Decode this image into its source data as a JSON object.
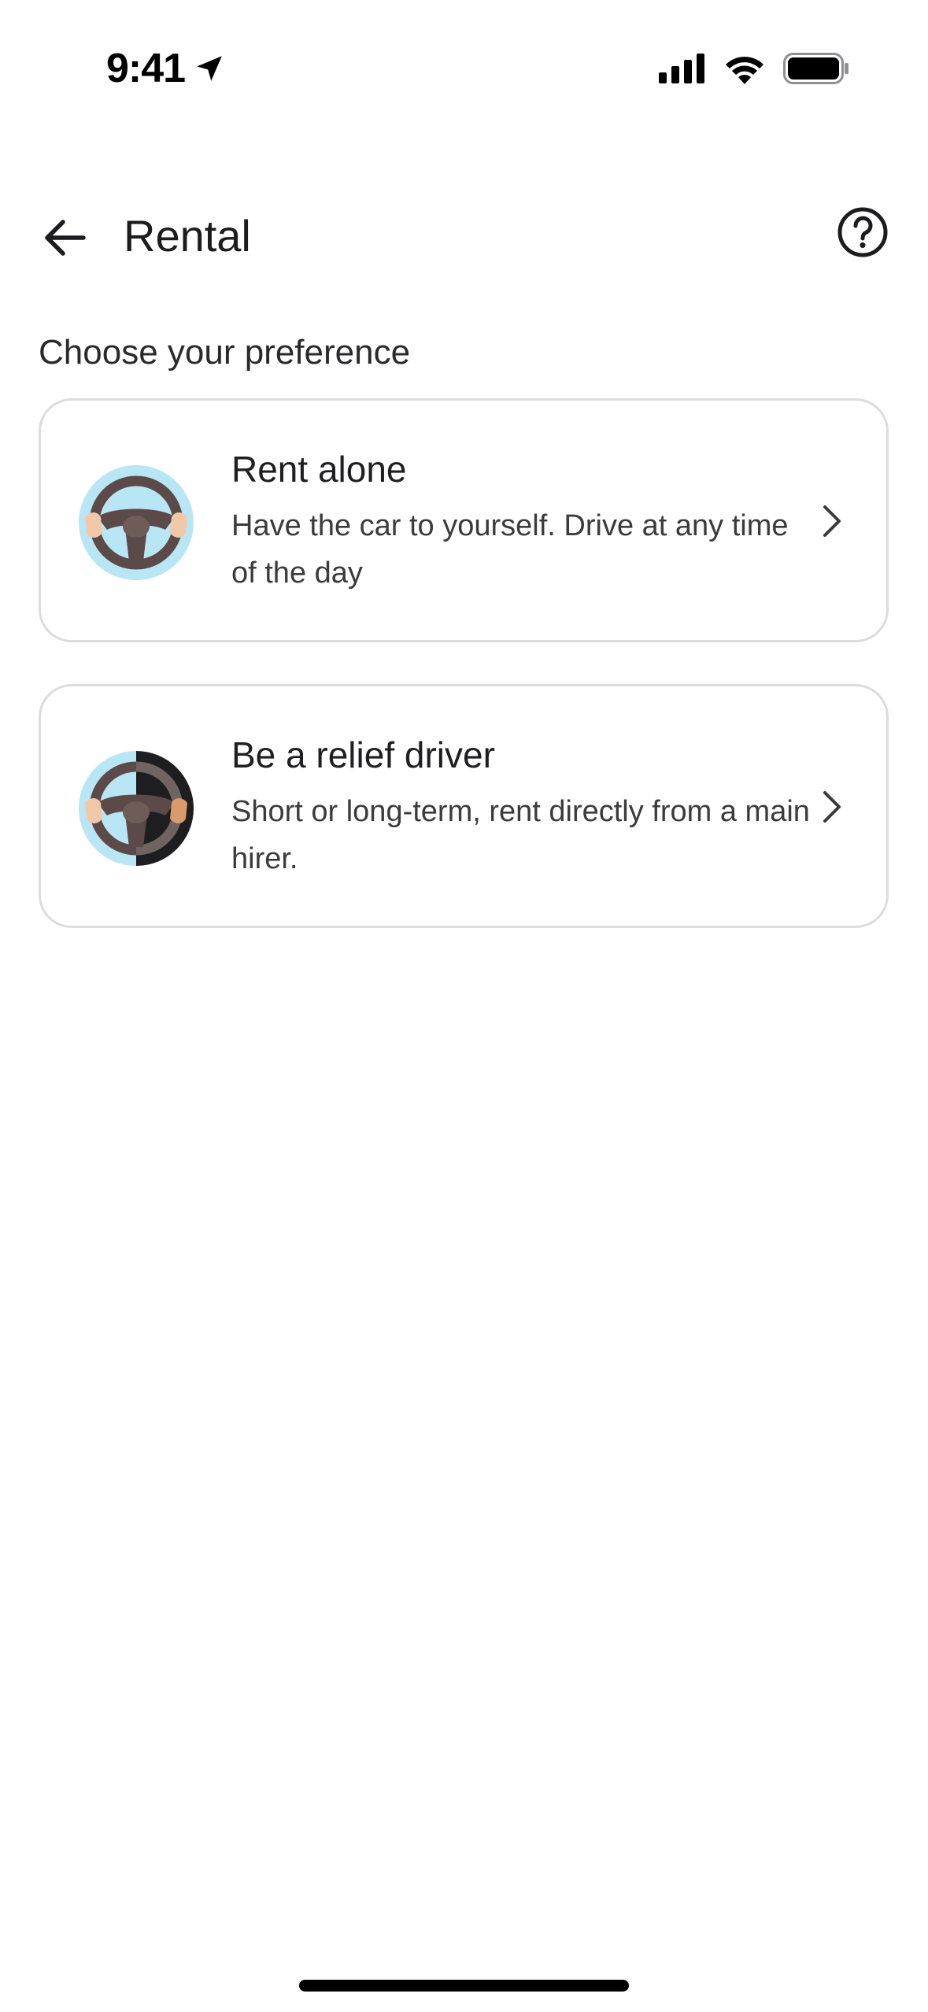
{
  "status_bar": {
    "time": "9:41",
    "icons": [
      "location-arrow-icon",
      "cellular-signal-icon",
      "wifi-icon",
      "battery-icon"
    ]
  },
  "header": {
    "title": "Rental",
    "back_icon": "back-arrow-icon",
    "help_icon": "help-circle-icon"
  },
  "section": {
    "title": "Choose your preference"
  },
  "options": [
    {
      "title": "Rent alone",
      "description": "Have the car to yourself. Drive at any time of the day",
      "icon": "steering-wheel-icon",
      "chevron": "chevron-right-icon"
    },
    {
      "title": "Be a relief driver",
      "description": "Short or long-term, rent directly from a main hirer.",
      "icon": "steering-wheel-split-icon",
      "chevron": "chevron-right-icon"
    }
  ],
  "colors": {
    "card_border": "#dcdcdc",
    "avatar_blue": "#b9e6f5",
    "wheel": "#5b4a48",
    "dark_half": "#1e1e20",
    "hand": "#f2c9a8"
  }
}
